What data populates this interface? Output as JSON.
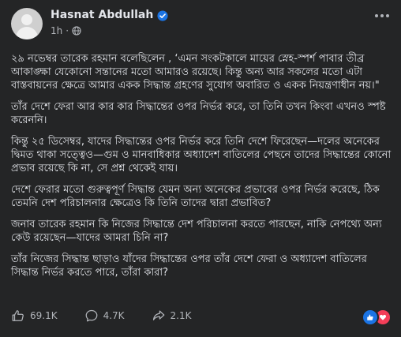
{
  "post": {
    "author": "Hasnat Abdullah",
    "time": "1h",
    "dot": "·",
    "paragraphs": [
      "২৯ নভেম্বর তারেক রহমান বলেছিলেন , ‘এমন সংকটকালে মায়ের স্নেহ-স্পর্শ পাবার তীব্র আকাঙ্ক্ষা যেকোনো সন্তানের মতো আমারও রয়েছে। কিন্তু অন্য আর সকলের মতো এটা বাস্তবায়নের ক্ষেত্রে আমার একক সিদ্ধান্ত গ্রহণের সুযোগ অবারিত ও একক নিয়ন্ত্রণাধীন নয়।\"",
      "তাঁর দেশে ফেরা আর কার কার সিদ্ধান্তের ওপর নির্ভর করে, তা তিনি তখন কিংবা এখনও স্পষ্ট করেননি।",
      "কিন্তু ২৫ ডিসেম্বর, যাদের সিদ্ধান্তের ওপর নির্ভর করে তিনি দেশে ফিরেছেন—দলের অনেকের দ্বিমত থাকা সত্ত্বেও—গুম ও মানবাধিকার অধ্যাদেশ বাতিলের পেছনে তাদের সিদ্ধান্তের কোনো প্রভাব রয়েছে কি না, সে প্রশ্ন থেকেই যায়।",
      "দেশে ফেরার মতো গুরুত্বপূর্ণ সিদ্ধান্ত যেমন অন্য অনেকের প্রভাবের ওপর নির্ভর করেছে, ঠিক তেমনি দেশ পরিচালনার ক্ষেত্রেও কি তিনি তাদের দ্বারা প্রভাবিত?",
      "জনাব তারেক রহমান কি নিজের সিদ্ধান্তে দেশ পরিচালনা করতে পারছেন, নাকি নেপথ্যে অন্য কেউ রয়েছেন—যাদের আমরা চিনি না?",
      "তাঁর নিজের সিদ্ধান্ত ছাড়াও যাঁদের সিদ্ধান্তের ওপর তাঁর দেশে ফেরা ও অধ্যাদেশ বাতিলের সিদ্ধান্ত নির্ভর করতে পারে, তাঁরা কারা?"
    ]
  },
  "footer": {
    "likes": "69.1K",
    "comments": "4.7K",
    "shares": "2.1K"
  },
  "icons": {
    "verified": "verified-badge-icon",
    "globe": "globe-icon",
    "like": "thumbs-up-icon",
    "comment": "comment-icon",
    "share": "share-icon",
    "reactions": [
      "like-reaction-icon",
      "love-reaction-icon"
    ]
  },
  "colors": {
    "background": "#242526",
    "text": "#e4e6eb",
    "muted": "#b0b3b8",
    "accent": "#1b74e4",
    "love": "#f33e58"
  }
}
